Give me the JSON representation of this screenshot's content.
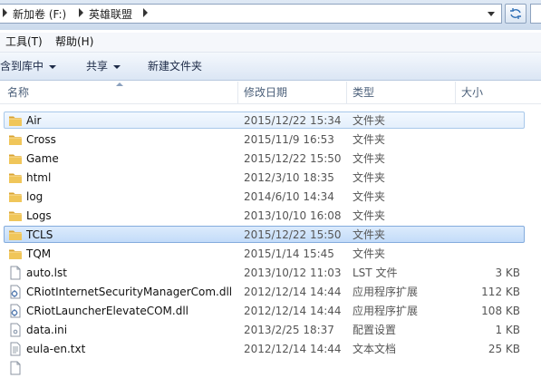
{
  "address_bar": {
    "breadcrumbs": [
      "新加卷 (F:)",
      "英雄联盟"
    ]
  },
  "menu": {
    "items": [
      "工具(T)",
      "帮助(H)"
    ]
  },
  "commands": {
    "include_library": "含到库中",
    "share": "共享",
    "new_folder": "新建文件夹"
  },
  "columns": {
    "name": "名称",
    "modified": "修改日期",
    "type": "类型",
    "size": "大小"
  },
  "files": [
    {
      "name": "Air",
      "modified": "2015/12/22 15:34",
      "type": "文件夹",
      "size": "",
      "icon": "folder-icon"
    },
    {
      "name": "Cross",
      "modified": "2015/11/9 16:53",
      "type": "文件夹",
      "size": "",
      "icon": "folder-icon"
    },
    {
      "name": "Game",
      "modified": "2015/12/22 15:50",
      "type": "文件夹",
      "size": "",
      "icon": "folder-icon"
    },
    {
      "name": "html",
      "modified": "2012/3/10 18:35",
      "type": "文件夹",
      "size": "",
      "icon": "folder-icon"
    },
    {
      "name": "log",
      "modified": "2014/6/10 14:34",
      "type": "文件夹",
      "size": "",
      "icon": "folder-icon"
    },
    {
      "name": "Logs",
      "modified": "2013/10/10 16:08",
      "type": "文件夹",
      "size": "",
      "icon": "folder-icon"
    },
    {
      "name": "TCLS",
      "modified": "2015/12/22 15:50",
      "type": "文件夹",
      "size": "",
      "icon": "folder-icon"
    },
    {
      "name": "TQM",
      "modified": "2015/1/14 15:45",
      "type": "文件夹",
      "size": "",
      "icon": "folder-icon"
    },
    {
      "name": "auto.lst",
      "modified": "2013/10/12 11:03",
      "type": "LST 文件",
      "size": "3 KB",
      "icon": "file-icon"
    },
    {
      "name": "CRiotInternetSecurityManagerCom.dll",
      "modified": "2012/12/14 14:44",
      "type": "应用程序扩展",
      "size": "112 KB",
      "icon": "dll-icon"
    },
    {
      "name": "CRiotLauncherElevateCOM.dll",
      "modified": "2012/12/14 14:44",
      "type": "应用程序扩展",
      "size": "108 KB",
      "icon": "dll-icon"
    },
    {
      "name": "data.ini",
      "modified": "2013/2/25 18:37",
      "type": "配置设置",
      "size": "1 KB",
      "icon": "ini-icon"
    },
    {
      "name": "eula-en.txt",
      "modified": "2012/12/14 14:44",
      "type": "文本文档",
      "size": "25 KB",
      "icon": "text-file-icon"
    },
    {
      "name": "",
      "modified": "",
      "type": "",
      "size": "",
      "icon": "file-icon"
    }
  ],
  "highlighted_rows": {
    "hover": 0,
    "selected": 6
  },
  "colors": {
    "folder": "#e8b646",
    "hover": "#e4effc",
    "selected": "#c3dcf9",
    "accent": "#84acdd"
  }
}
